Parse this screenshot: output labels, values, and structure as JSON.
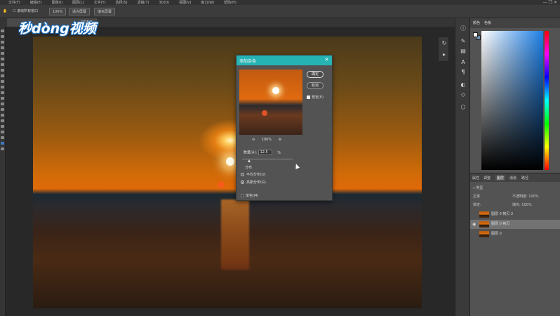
{
  "menubar": {
    "items": [
      "文件(F)",
      "编辑(E)",
      "图像(I)",
      "图层(L)",
      "文字(Y)",
      "选择(S)",
      "滤镜(T)",
      "3D(D)",
      "视图(V)",
      "窗口(W)",
      "帮助(H)"
    ]
  },
  "window_controls": "— ❐ ✕",
  "options": {
    "scroll_all": "滚动所有窗口",
    "zoom": "100%",
    "fit_screen": "适合屏幕",
    "fill_screen": "填充屏幕"
  },
  "document": {
    "tab_label": "RGB/8"
  },
  "logo": {
    "text": "秒dòng视频"
  },
  "color_panel": {
    "tab_color": "颜色",
    "tab_swatches": "色板"
  },
  "layers_panel": {
    "tabs": [
      "属性",
      "调整",
      "图层",
      "通道",
      "路径"
    ],
    "kind_label": "类型",
    "blend_mode": "正常",
    "opacity_label": "不透明度: 100%",
    "lock_label": "锁定:",
    "fill_label": "填充: 100%",
    "layers": [
      {
        "name": "图层 0 拷贝 2",
        "visible": false,
        "selected": false
      },
      {
        "name": "图层 0 拷贝",
        "visible": true,
        "selected": true
      },
      {
        "name": "图层 0",
        "visible": false,
        "selected": false
      }
    ]
  },
  "dialog": {
    "title": "添加杂色",
    "ok_label": "确定",
    "cancel_label": "取消",
    "preview_label": "预览(P)",
    "zoom_value": "100%",
    "amount_label": "数量(A):",
    "amount_value": "12.5",
    "amount_unit": "%",
    "distribution_label": "分布",
    "uniform_label": "平均分布(U)",
    "gaussian_label": "高斯分布(G)",
    "gaussian_selected": true,
    "monochrome_label": "单色(M)"
  }
}
